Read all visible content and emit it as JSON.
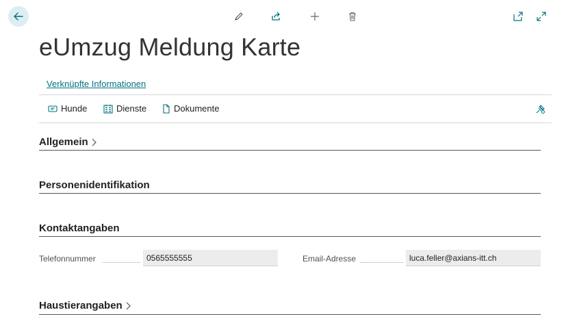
{
  "page": {
    "title": "eUmzug Meldung Karte",
    "related_link": "Verknüpfte Informationen"
  },
  "actions": [
    {
      "label": "Hunde",
      "icon": "dog-card-icon"
    },
    {
      "label": "Dienste",
      "icon": "services-icon"
    },
    {
      "label": "Dokumente",
      "icon": "document-icon"
    }
  ],
  "sections": {
    "allgemein": "Allgemein",
    "personen": "Personenidentifikation",
    "kontakt": "Kontaktangaben",
    "haustier": "Haustierangaben"
  },
  "fields": {
    "telefon": {
      "label": "Telefonnummer",
      "value": "0565555555"
    },
    "email": {
      "label": "Email-Adresse",
      "value": "luca.feller@axians-itt.ch"
    }
  },
  "colors": {
    "accent": "#00727f",
    "back_bg": "#dceef3"
  }
}
